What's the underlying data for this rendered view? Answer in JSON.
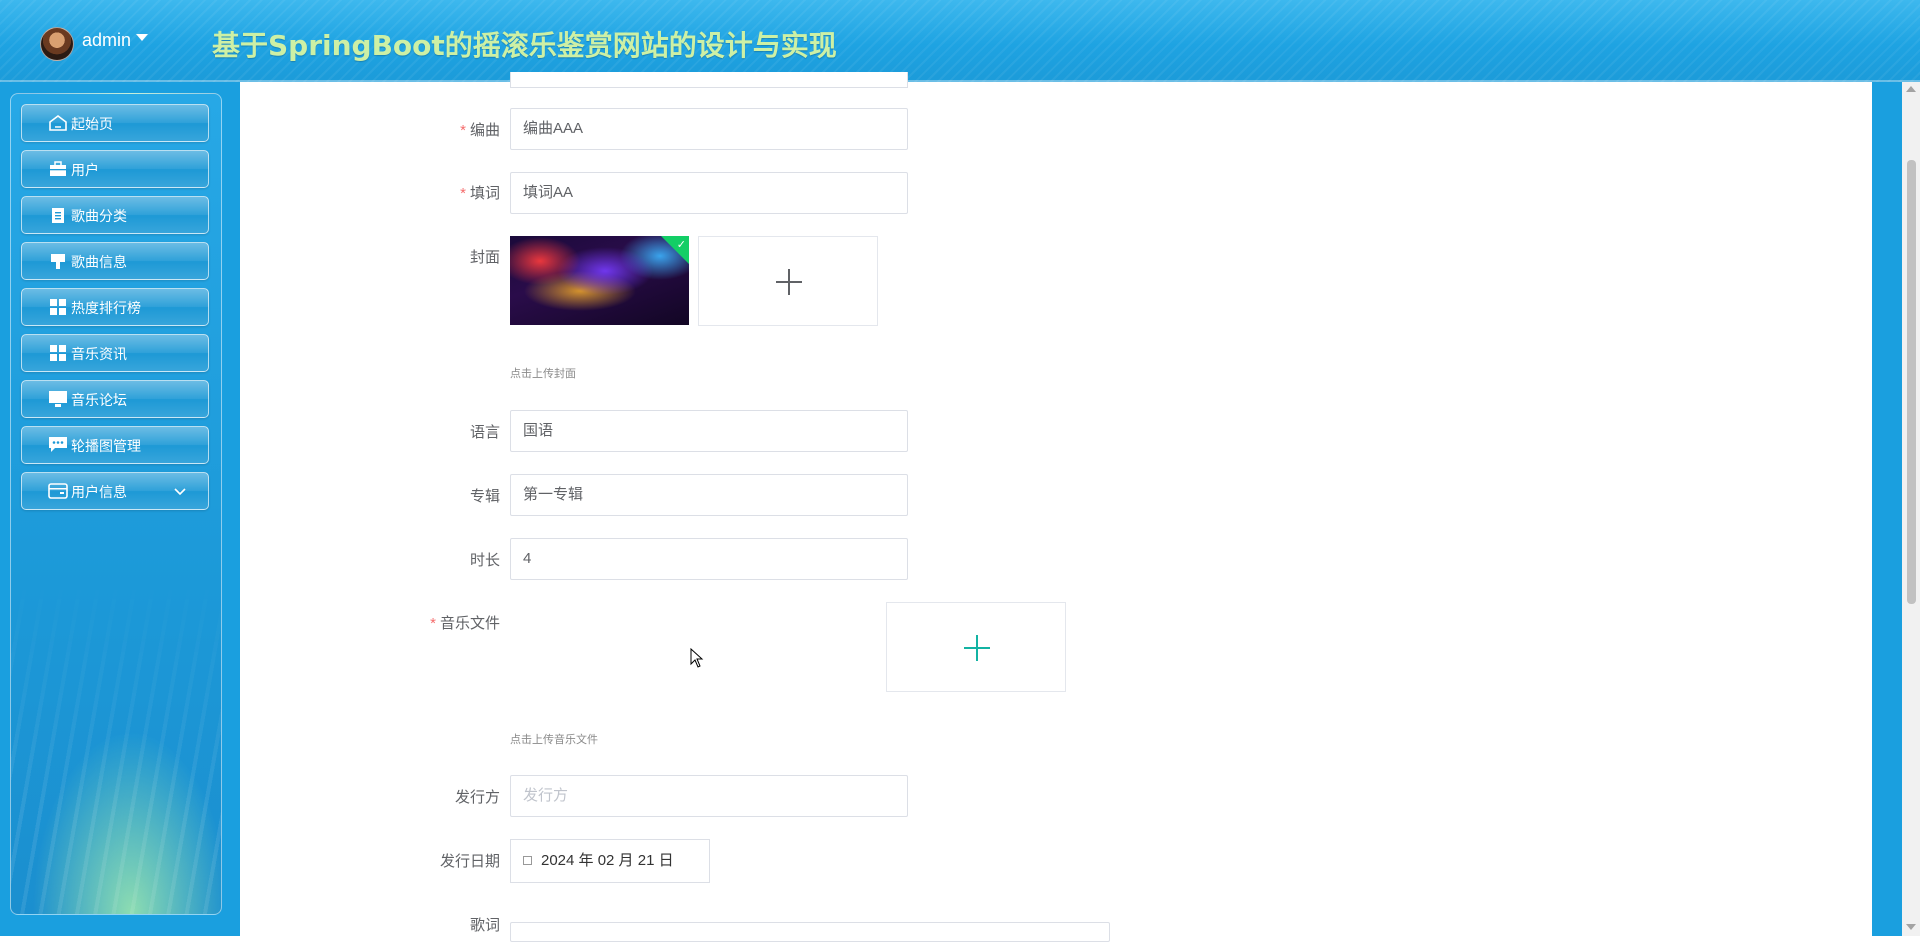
{
  "header": {
    "username": "admin",
    "site_title": "基于SpringBoot的摇滚乐鉴赏网站的设计与实现"
  },
  "sidebar": {
    "items": [
      {
        "label": "起始页",
        "icon": "home-icon"
      },
      {
        "label": "用户",
        "icon": "briefcase-icon"
      },
      {
        "label": "歌曲分类",
        "icon": "clipboard-icon"
      },
      {
        "label": "歌曲信息",
        "icon": "brush-icon"
      },
      {
        "label": "热度排行榜",
        "icon": "grid-icon"
      },
      {
        "label": "音乐资讯",
        "icon": "grid-icon"
      },
      {
        "label": "音乐论坛",
        "icon": "monitor-icon"
      },
      {
        "label": "轮播图管理",
        "icon": "chat-icon"
      },
      {
        "label": "用户信息",
        "icon": "card-icon",
        "expandable": true
      }
    ]
  },
  "form": {
    "composer": {
      "label": "编曲",
      "required": true,
      "value": "编曲AAA"
    },
    "lyricist": {
      "label": "填词",
      "required": true,
      "value": "填词AA"
    },
    "cover": {
      "label": "封面",
      "hint": "点击上传封面"
    },
    "language": {
      "label": "语言",
      "value": "国语"
    },
    "album": {
      "label": "专辑",
      "value": "第一专辑"
    },
    "duration": {
      "label": "时长",
      "value": "4"
    },
    "music_file": {
      "label": "音乐文件",
      "required": true,
      "hint": "点击上传音乐文件"
    },
    "publisher": {
      "label": "发行方",
      "placeholder": "发行方"
    },
    "release_date": {
      "label": "发行日期",
      "value": "2024 年 02 月 21 日"
    },
    "lyrics": {
      "label": "歌词"
    }
  },
  "colors": {
    "header_bg": "#1ea3e2",
    "title_color": "#cdf0a5",
    "required_star": "#f56c6c",
    "accent_plus": "#13b3a3",
    "upload_done_corner": "#13ce66"
  }
}
